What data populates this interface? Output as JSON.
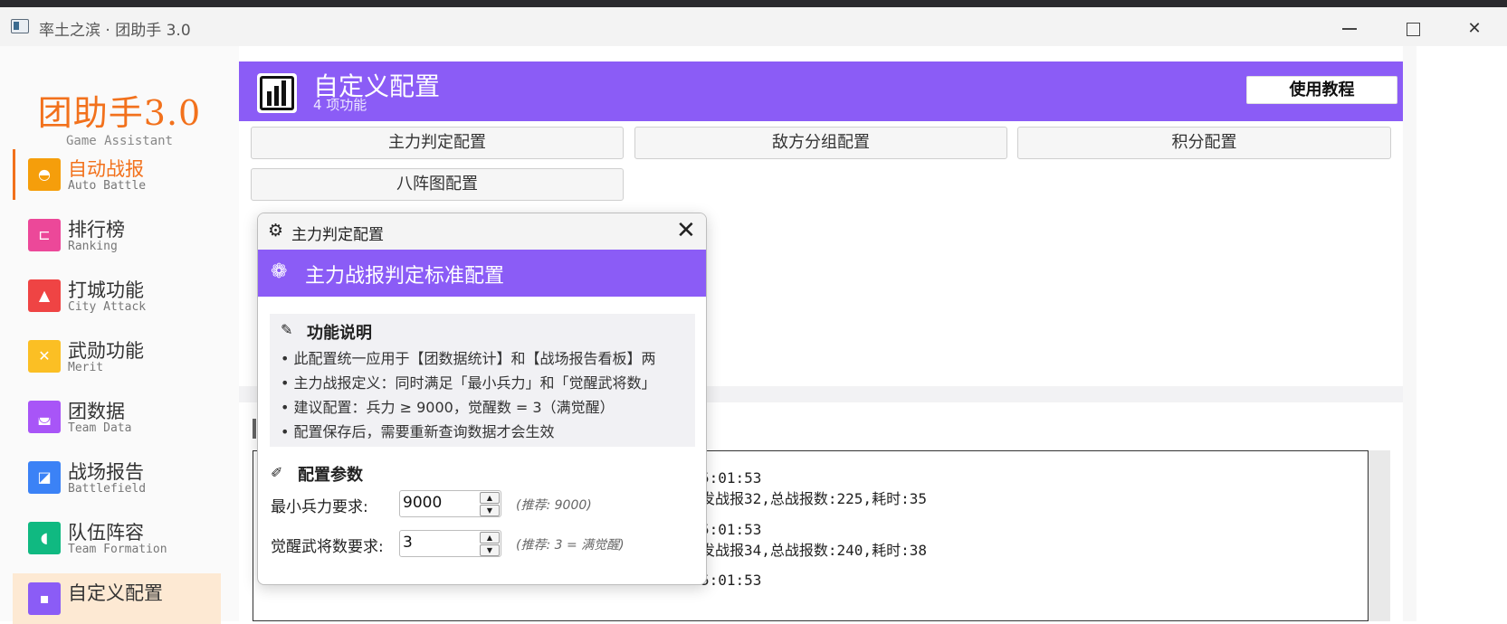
{
  "window": {
    "title": "率土之滨 · 团助手 3.0",
    "controls": {
      "minimize": "minimize",
      "maximize": "maximize",
      "close": "✕"
    }
  },
  "sidebar": {
    "brand": "团助手3.0",
    "brand_sub": "Game Assistant",
    "items": [
      {
        "label": "自动战报",
        "sub": "Auto Battle",
        "icon": "helmet-icon",
        "glyph": "◓",
        "color": "#f59e0b",
        "active": true
      },
      {
        "label": "排行榜",
        "sub": "Ranking",
        "icon": "ranking-icon",
        "glyph": "⊏",
        "color": "#ec4899",
        "active": false
      },
      {
        "label": "打城功能",
        "sub": "City Attack",
        "icon": "city-icon",
        "glyph": "▲",
        "color": "#ef4444",
        "active": false
      },
      {
        "label": "武勋功能",
        "sub": "Merit",
        "icon": "swords-icon",
        "glyph": "✕",
        "color": "#fbbf24",
        "active": false
      },
      {
        "label": "团数据",
        "sub": "Team Data",
        "icon": "team-data-icon",
        "glyph": "◛",
        "color": "#a855f7",
        "active": false
      },
      {
        "label": "战场报告",
        "sub": "Battlefield",
        "icon": "battlefield-icon",
        "glyph": "◪",
        "color": "#3b82f6",
        "active": false
      },
      {
        "label": "队伍阵容",
        "sub": "Team Formation",
        "icon": "formation-icon",
        "glyph": "◖",
        "color": "#10b981",
        "active": false
      },
      {
        "label": "自定义配置",
        "sub": "",
        "icon": "settings-icon",
        "glyph": "▪",
        "color": "#8b5cf6",
        "active": false
      }
    ]
  },
  "header": {
    "title": "自定义配置",
    "subtitle": "4 项功能",
    "tutorial_button": "使用教程",
    "color": "#8b5cf6"
  },
  "tabs": [
    "主力判定配置",
    "敌方分组配置",
    "积分配置",
    "八阵图配置"
  ],
  "log": {
    "lines": [
      "5:01:53",
      "发战报32,总战报数:225,耗时:35",
      "5:01:53",
      "发战报34,总战报数:240,耗时:38",
      "5:01:53"
    ]
  },
  "dialog": {
    "title": "主力判定配置",
    "close": "✕",
    "banner_title": "主力战报判定标准配置",
    "info": {
      "heading": "功能说明",
      "lines": [
        "• 此配置统一应用于【团数据统计】和【战场报告看板】两",
        "• 主力战报定义：同时满足「最小兵力」和「觉醒武将数」",
        "• 建议配置：兵力 ≥ 9000，觉醒数 = 3（满觉醒）",
        "• 配置保存后，需要重新查询数据才会生效"
      ]
    },
    "params_heading": "配置参数",
    "fields": [
      {
        "label": "最小兵力要求:",
        "value": "9000",
        "hint": "(推荐: 9000)"
      },
      {
        "label": "觉醒武将数要求:",
        "value": "3",
        "hint": "(推荐: 3 = 满觉醒)"
      }
    ]
  }
}
